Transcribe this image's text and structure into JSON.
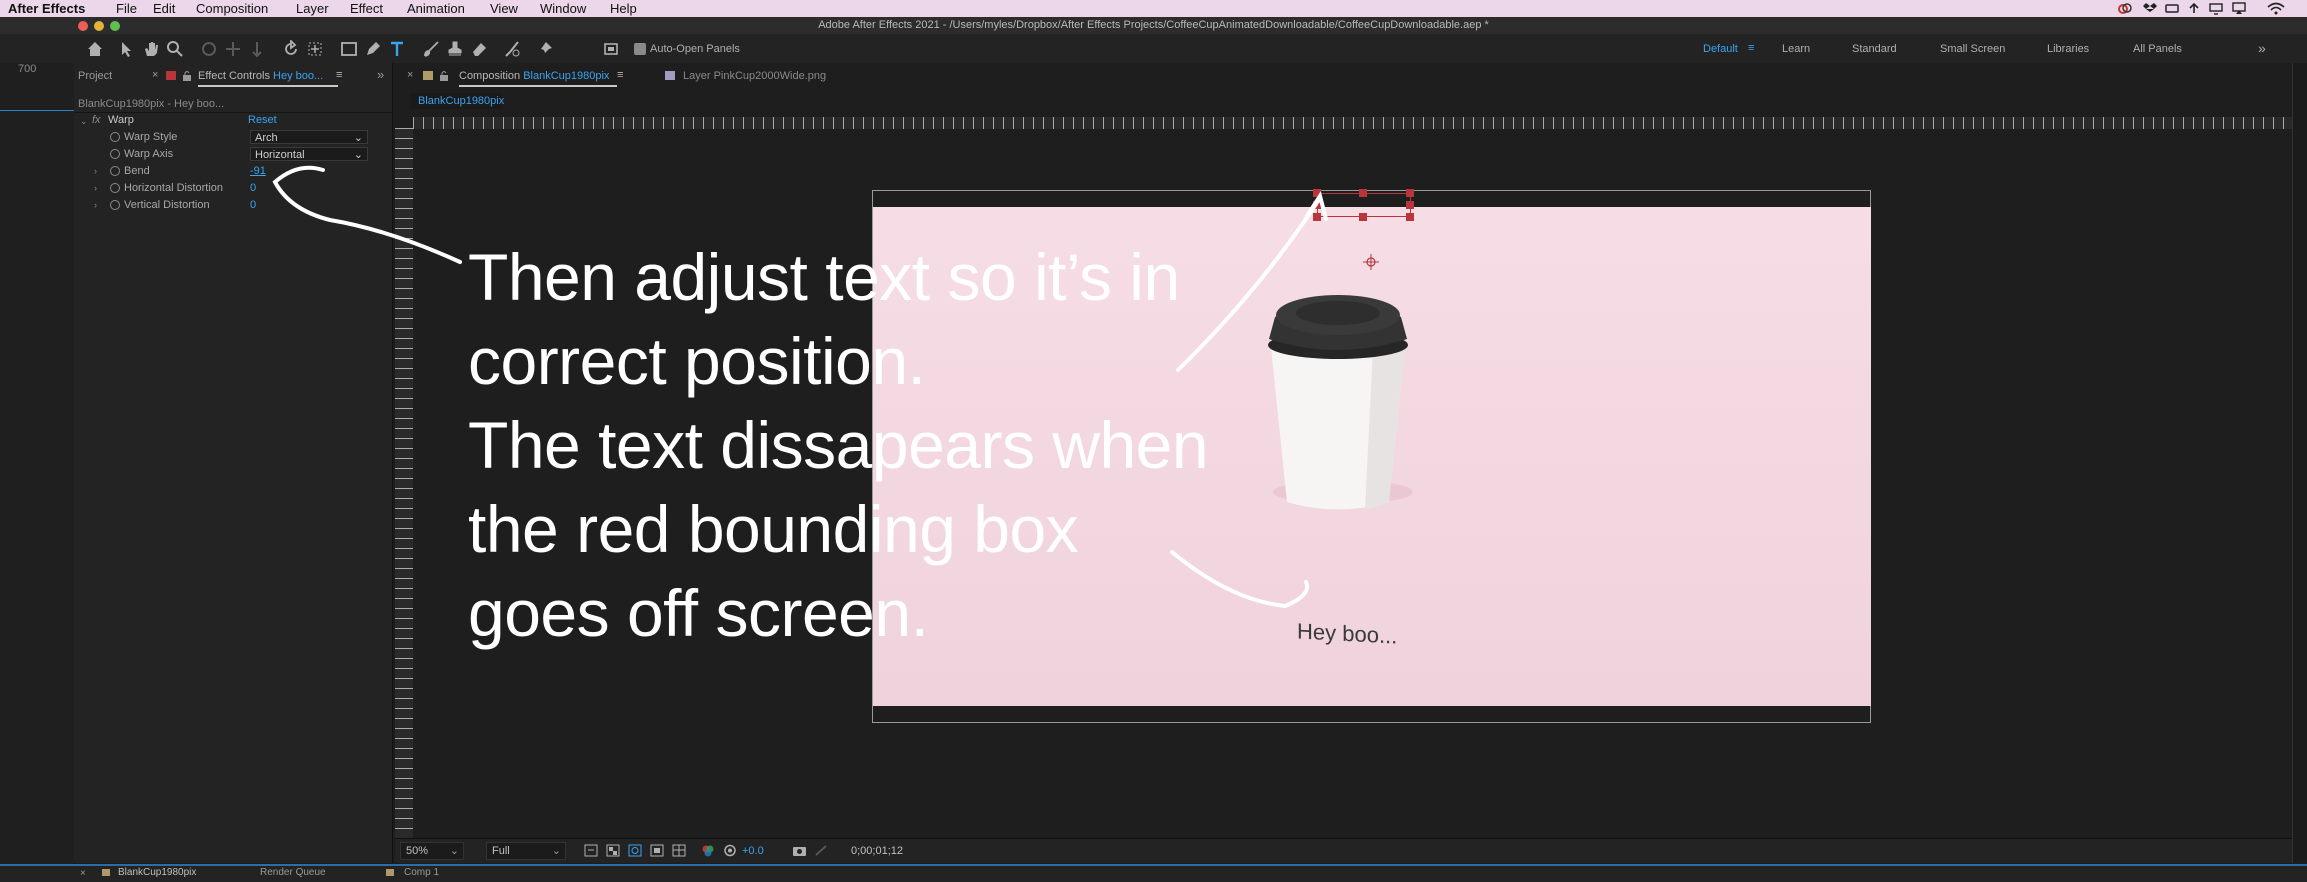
{
  "menubar": {
    "app_name": "After Effects",
    "items": [
      "File",
      "Edit",
      "Composition",
      "Layer",
      "Effect",
      "Animation",
      "View",
      "Window",
      "Help"
    ]
  },
  "window": {
    "title": "Adobe After Effects 2021 - /Users/myles/Dropbox/After Effects Projects/CoffeeCupAnimatedDownloadable/CoffeeCupDownloadable.aep *"
  },
  "toolbar": {
    "auto_open_label": "Auto-Open Panels",
    "workspaces": [
      "Default",
      "Learn",
      "Standard",
      "Small Screen",
      "Libraries",
      "All Panels"
    ],
    "active_workspace": "Default"
  },
  "left_strip": {
    "value": "700"
  },
  "effect_panel": {
    "tab_project": "Project",
    "tab_effect_prefix": "Effect Controls",
    "tab_effect_layer": "Hey boo...",
    "breadcrumb": "BlankCup1980pix - Hey boo...",
    "effect_name": "Warp",
    "fx_label": "fx",
    "reset_label": "Reset",
    "props": {
      "warp_style": {
        "label": "Warp Style",
        "value": "Arch"
      },
      "warp_axis": {
        "label": "Warp Axis",
        "value": "Horizontal"
      },
      "bend": {
        "label": "Bend",
        "value": "-91"
      },
      "horizontal_distortion": {
        "label": "Horizontal Distortion",
        "value": "0"
      },
      "vertical_distortion": {
        "label": "Vertical Distortion",
        "value": "0"
      }
    }
  },
  "comp_panel": {
    "tab_prefix": "Composition",
    "tab_comp_name": "BlankCup1980pix",
    "tab_layer": "Layer PinkCup2000Wide.png",
    "subtab": "BlankCup1980pix"
  },
  "canvas": {
    "cup_text": "Hey boo..."
  },
  "annotation": {
    "lines": [
      "Then adjust text so it’s in",
      "correct position.",
      "The text dissapears when",
      "the red bounding box",
      "goes off screen."
    ]
  },
  "viewer_footer": {
    "zoom": "50%",
    "resolution": "Full",
    "exposure": "+0.0",
    "timecode": "0;00;01;12"
  },
  "timeline": {
    "tabs": [
      "BlankCup1980pix",
      "Render Queue",
      "Comp 1"
    ]
  },
  "colors": {
    "accent": "#3aa4f0",
    "bounding_box": "#b8353b",
    "canvas_pink": "#f4d9e2"
  }
}
